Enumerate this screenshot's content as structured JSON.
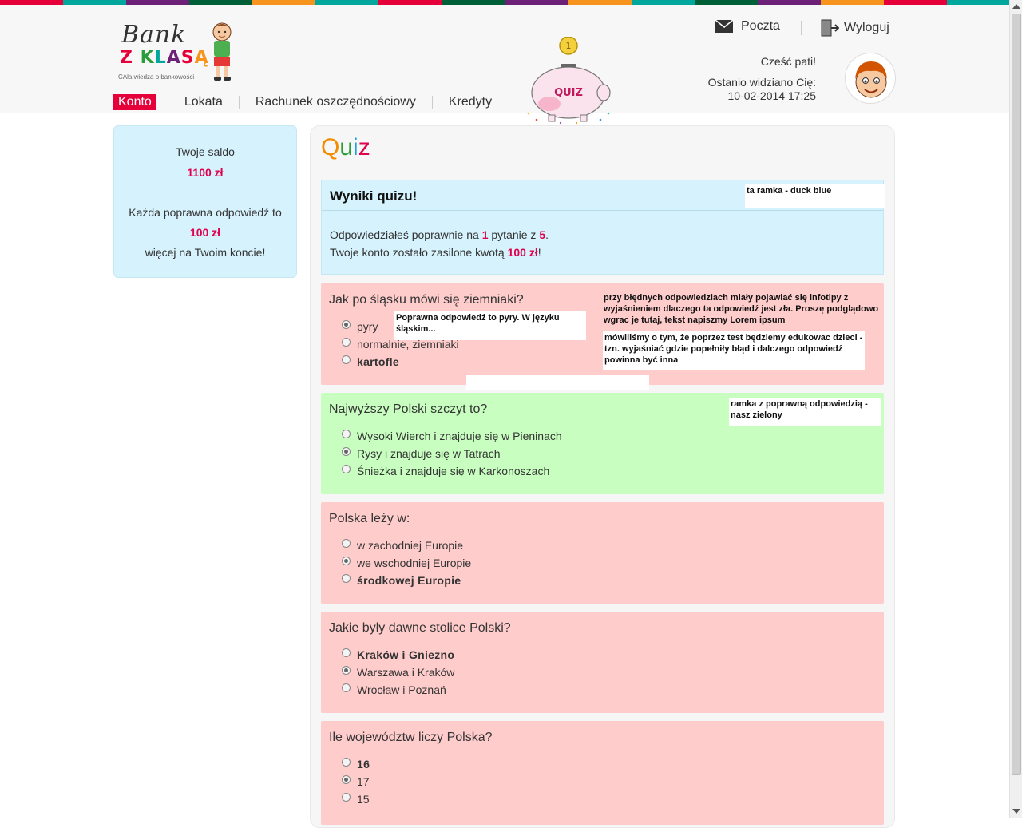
{
  "stripe_colors": [
    "#e5003a",
    "#00a79d",
    "#6d2077",
    "#005f36",
    "#f7941d",
    "#00a79d",
    "#e5003a",
    "#005f36",
    "#6d2077",
    "#f7941d",
    "#00a79d",
    "#005f36",
    "#6d2077",
    "#f7941d",
    "#e5003a",
    "#00a79d"
  ],
  "logo": {
    "bank": "Bank",
    "zklasa": "Z KLASĄ",
    "tagline": "CAła wiedza o bankowości"
  },
  "nav": {
    "items": [
      "Konto",
      "Lokata",
      "Rachunek oszczędnościowy",
      "Kredyty"
    ],
    "active": "Konto"
  },
  "piggy_label": "QUIZ",
  "topright": {
    "mail_label": "Poczta",
    "logout_label": "Wyloguj",
    "greeting": "Cześć pati!",
    "last_seen_label": "Ostanio widziano Cię:",
    "last_seen_value": "10-02-2014 17:25"
  },
  "sidebar": {
    "balance_label": "Twoje saldo",
    "balance_value": "1100 zł",
    "reward_text": "Każda poprawna odpowiedź to",
    "reward_value": "100 zł",
    "reward_suffix": "więcej na Twoim koncie!"
  },
  "main": {
    "title_q": "Q",
    "title_u": "u",
    "title_i": "i",
    "title_z": "z",
    "results": {
      "heading": "Wyniki quizu!",
      "line1_pre": "Odpowiedziałeś poprawnie na",
      "correct_count": "1",
      "line1_mid": "pytanie z",
      "total_count": "5",
      "line1_end": ".",
      "line2_pre": "Twoje konto zostało zasilone kwotą",
      "amount": "100 zł",
      "line2_end": "!"
    },
    "questions": [
      {
        "text": "Jak po śląsku mówi się ziemniaki?",
        "status": "wrong",
        "options": [
          {
            "label": "pyry",
            "selected": true,
            "correct": false
          },
          {
            "label": "normalnie, ziemniaki",
            "selected": false,
            "correct": false
          },
          {
            "label": "kartofle",
            "selected": false,
            "correct": true
          }
        ]
      },
      {
        "text": "Najwyższy Polski szczyt to?",
        "status": "right",
        "options": [
          {
            "label": "Wysoki Wierch i znajduje się w Pieninach",
            "selected": false,
            "correct": false
          },
          {
            "label": "Rysy i znajduje się w Tatrach",
            "selected": true,
            "correct": false
          },
          {
            "label": "Śnieżka i znajduje się w Karkonoszach",
            "selected": false,
            "correct": false
          }
        ]
      },
      {
        "text": "Polska leży w:",
        "status": "wrong",
        "options": [
          {
            "label": "w zachodniej Europie",
            "selected": false,
            "correct": false
          },
          {
            "label": "we wschodniej Europie",
            "selected": true,
            "correct": false
          },
          {
            "label": "środkowej Europie",
            "selected": false,
            "correct": true
          }
        ]
      },
      {
        "text": "Jakie były dawne stolice Polski?",
        "status": "wrong",
        "options": [
          {
            "label": "Kraków i Gniezno",
            "selected": false,
            "correct": true
          },
          {
            "label": "Warszawa i Kraków",
            "selected": true,
            "correct": false
          },
          {
            "label": "Wrocław i Poznań",
            "selected": false,
            "correct": false
          }
        ]
      },
      {
        "text": "Ile województw liczy Polska?",
        "status": "wrong",
        "options": [
          {
            "label": "16",
            "selected": false,
            "correct": true
          },
          {
            "label": "17",
            "selected": true,
            "correct": false
          },
          {
            "label": "15",
            "selected": false,
            "correct": false
          }
        ]
      }
    ]
  },
  "annotations": {
    "results_note": "ta ramka - duck blue",
    "tooltip": "Poprawna odpowiedź to pyry. W języku śląskim...",
    "infotip_note": "przy błędnych odpowiedziach miały pojawiać się infotipy z wyjaśnieniem dlaczego ta odpowiedź jest zła. Proszę podglądowo wgrac je tutaj, tekst napiszmy Lorem ipsum",
    "edu_note": "mówiliśmy o tym, że poprzez test będziemy edukowac dzieci - tzn. wyjaśniać gdzie popełniły błąd i dalczego odpowiedź powinna być inna",
    "green_note": "ramka z poprawną odpowiedzią - nasz zielony"
  },
  "colors": {
    "accent": "#e5003a",
    "blue_panel": "#d6f2fd",
    "wrong": "#ffcccc",
    "right": "#c8ffc0",
    "title_q": "#f28c00",
    "title_u": "#2a9d3a",
    "title_i": "#1aa3d6",
    "title_z": "#e0004d"
  }
}
